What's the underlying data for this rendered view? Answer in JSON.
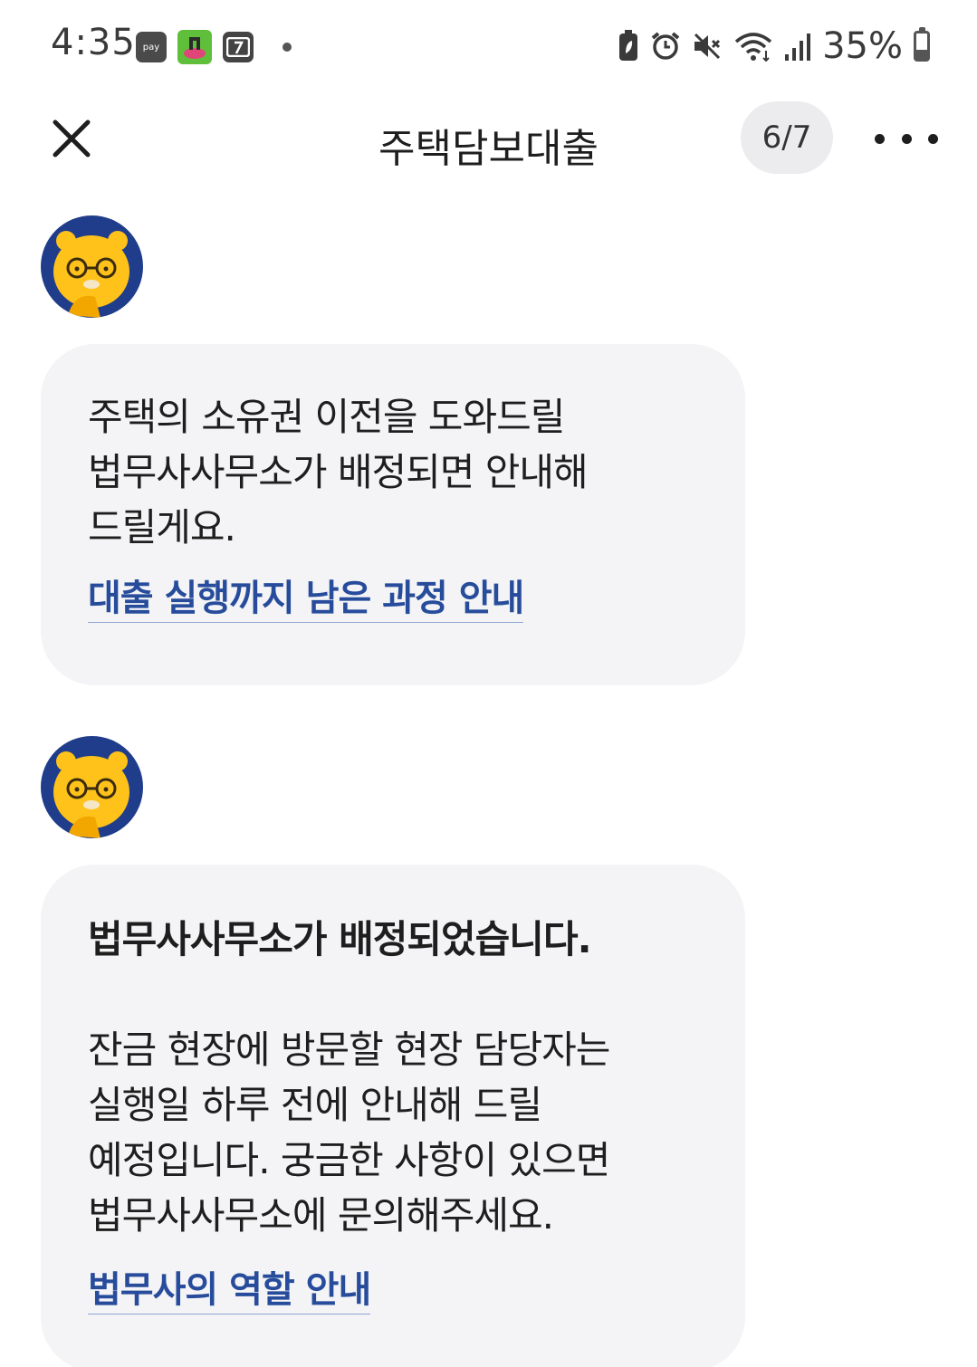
{
  "status_bar": {
    "time": "4:35",
    "left_icons": [
      "pay-icon",
      "game-app-icon",
      "notification-app-icon",
      "more-notifications-dot"
    ],
    "right_icons": [
      "battery-saver-icon",
      "alarm-icon",
      "mute-icon",
      "wifi-icon",
      "signal-icon"
    ],
    "battery_text": "35%",
    "battery_level": 0.35,
    "pay_label": "pay"
  },
  "header": {
    "title": "주택담보대출",
    "step": "6/7"
  },
  "messages": [
    {
      "body": "주택의 소유권 이전을 도와드릴\n법무사사무소가 배정되면 안내해\n드릴게요.",
      "link": "대출 실행까지 남은 과정 안내"
    },
    {
      "heading": "법무사사무소가 배정되었습니다.",
      "body": "잔금 현장에 방문할 현장 담당자는\n실행일 하루 전에 안내해 드릴\n예정입니다. 궁금한 사항이 있으면\n법무사사무소에 문의해주세요.",
      "link": "법무사의 역할 안내"
    }
  ],
  "colors": {
    "bubble_bg": "#f4f4f6",
    "link": "#274c9b",
    "avatar_bg": "#1f3d8a",
    "character": "#ffc21a",
    "step_pill_bg": "#ececef"
  }
}
